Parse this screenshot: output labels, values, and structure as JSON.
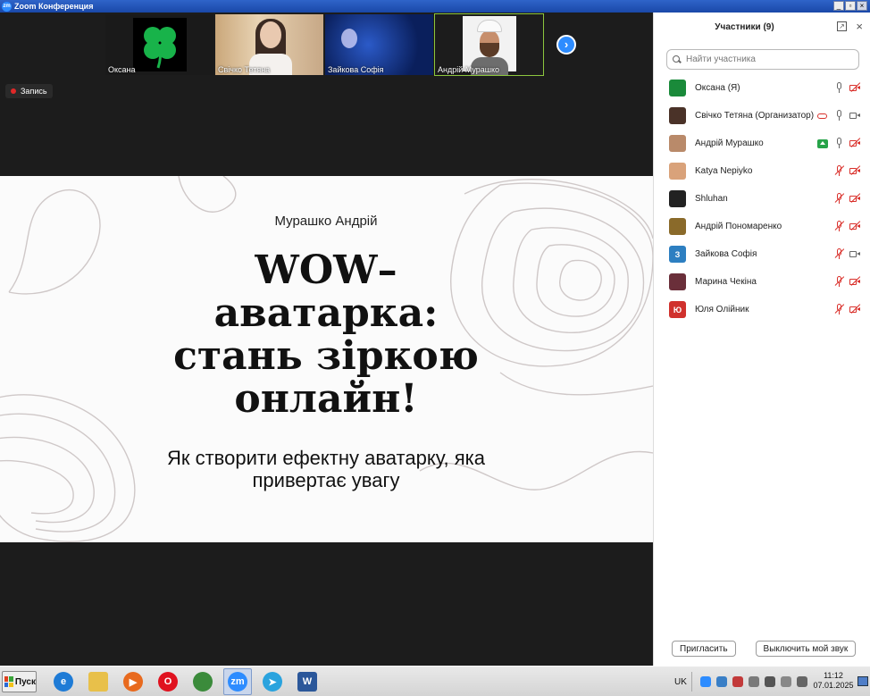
{
  "window": {
    "title": "Zoom Конференция"
  },
  "thumbnails": [
    {
      "name": "Оксана",
      "active": false
    },
    {
      "name": "Свічко Тетяна",
      "active": false
    },
    {
      "name": "Зайкова Софія",
      "active": false
    },
    {
      "name": "Андрій Мурашко",
      "active": true
    }
  ],
  "recording": {
    "label": "Запись"
  },
  "slide": {
    "author": "Мурашко Андрій",
    "headline_lines": [
      "WOW–",
      "аватарка:",
      "стань зіркою",
      "онлайн!"
    ],
    "subtitle_lines": [
      "Як створити ефектну аватарку, яка",
      "привертає увагу"
    ]
  },
  "panel": {
    "title": "Участники (9)",
    "search_placeholder": "Найти участника",
    "participants": [
      {
        "name": "Оксана (Я)",
        "avatar_color": "#1a8a3a",
        "avatar_text": "",
        "mic": "on",
        "cam": "off",
        "extra": ""
      },
      {
        "name": "Свічко Тетяна (Организатор)",
        "avatar_color": "#4a3228",
        "avatar_text": "",
        "mic": "on",
        "cam": "on",
        "extra": "cloud"
      },
      {
        "name": "Андрій Мурашко",
        "avatar_color": "#b98a6a",
        "avatar_text": "",
        "mic": "on",
        "cam": "off",
        "extra": "share"
      },
      {
        "name": "Katya Nepiyko",
        "avatar_color": "#d9a27a",
        "avatar_text": "",
        "mic": "off",
        "cam": "off",
        "extra": ""
      },
      {
        "name": "Shluhan",
        "avatar_color": "#222222",
        "avatar_text": "",
        "mic": "off",
        "cam": "off",
        "extra": ""
      },
      {
        "name": "Андрій Пономаренко",
        "avatar_color": "#8a6a2a",
        "avatar_text": "",
        "mic": "off",
        "cam": "off",
        "extra": ""
      },
      {
        "name": "Зайкова Софія",
        "avatar_color": "#2d7fc1",
        "avatar_text": "З",
        "mic": "off",
        "cam": "on",
        "extra": ""
      },
      {
        "name": "Марина Чекіна",
        "avatar_color": "#6a2f3a",
        "avatar_text": "",
        "mic": "off",
        "cam": "off",
        "extra": ""
      },
      {
        "name": "Юля Олійник",
        "avatar_color": "#d0312d",
        "avatar_text": "Ю",
        "mic": "off",
        "cam": "off",
        "extra": ""
      }
    ],
    "invite_label": "Пригласить",
    "mute_label": "Выключить мой звук"
  },
  "taskbar": {
    "start_label": "Пуск",
    "apps": [
      {
        "name": "internet-explorer",
        "glyph": "e",
        "color": "#1e7bd6"
      },
      {
        "name": "file-explorer",
        "glyph": "",
        "color": "#e8c04a"
      },
      {
        "name": "media-player",
        "glyph": "▶",
        "color": "#e86a1e"
      },
      {
        "name": "opera",
        "glyph": "O",
        "color": "#e0121f"
      },
      {
        "name": "chrome",
        "glyph": "",
        "color": "#3b8b3b"
      },
      {
        "name": "zoom",
        "glyph": "zm",
        "color": "#2d8cff"
      },
      {
        "name": "telegram",
        "glyph": "➤",
        "color": "#2aa3de"
      },
      {
        "name": "word",
        "glyph": "W",
        "color": "#2b579a"
      }
    ],
    "language": "UK",
    "time": "11:12",
    "date": "07.01.2025"
  }
}
